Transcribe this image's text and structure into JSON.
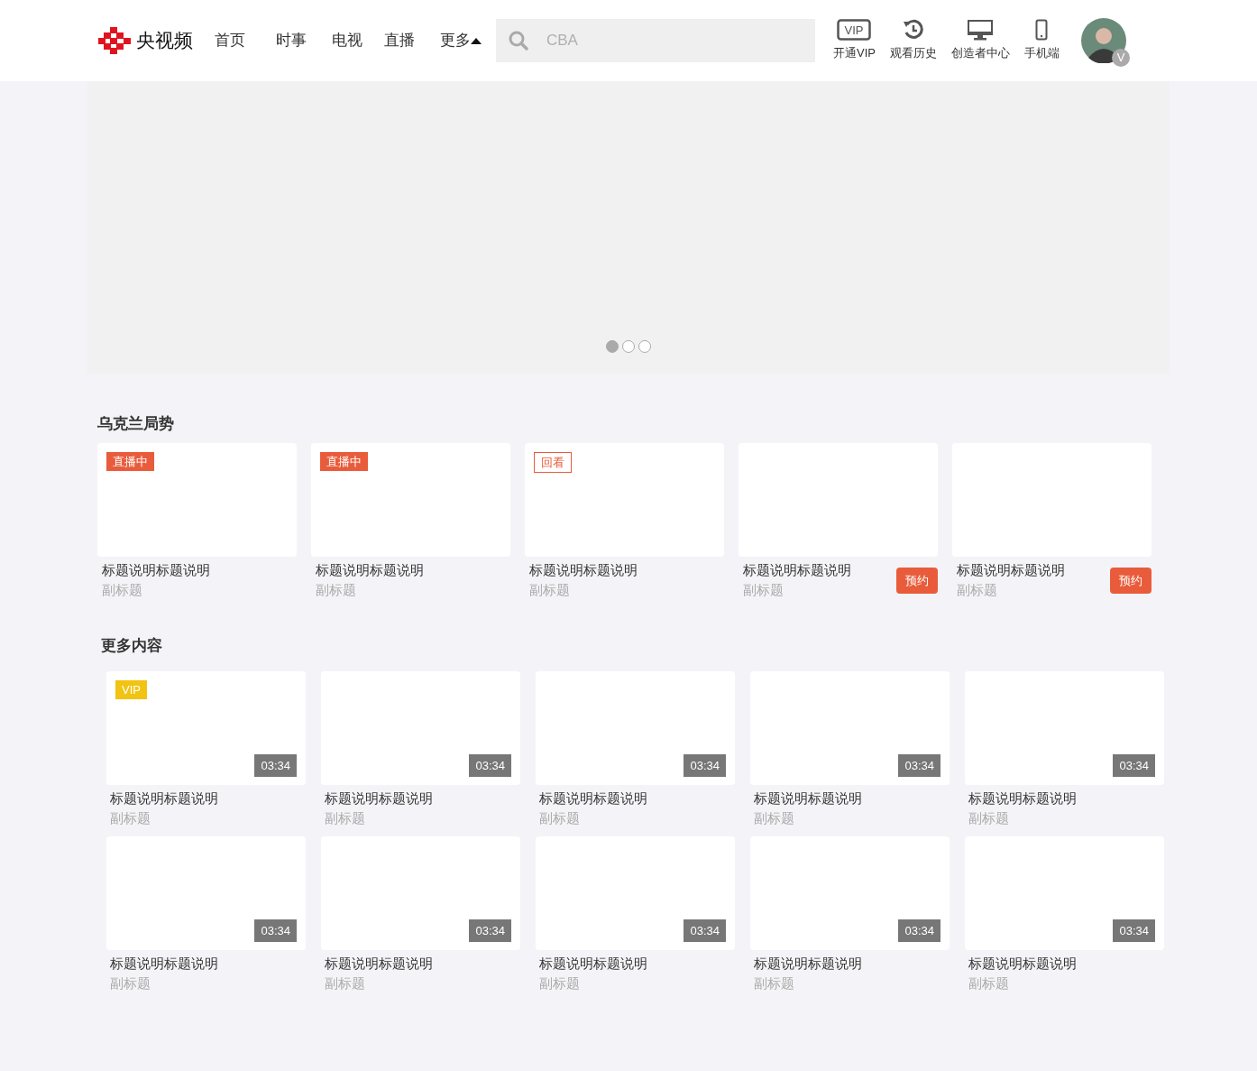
{
  "header": {
    "logo": "央视频",
    "nav": [
      "首页",
      "时事",
      "电视",
      "直播"
    ],
    "more": "更多",
    "search": {
      "placeholder": "CBA"
    },
    "actions": [
      {
        "kind": "vip",
        "label": "开通VIP",
        "icon_text": "VIP"
      },
      {
        "kind": "history",
        "label": "观看历史"
      },
      {
        "kind": "monitor",
        "label": "创造者中心"
      },
      {
        "kind": "phone",
        "label": "手机端"
      }
    ],
    "avatar_badge": "V"
  },
  "banner": {
    "dots": [
      {
        "selected": true
      },
      {
        "selected": false
      },
      {
        "selected": false
      }
    ]
  },
  "sections": [
    {
      "title": "乌克兰局势",
      "items": [
        {
          "tag": {
            "kind": "live",
            "text": "直播中"
          },
          "title": "标题说明标题说明",
          "subtitle": "副标题"
        },
        {
          "tag": {
            "kind": "live",
            "text": "直播中"
          },
          "title": "标题说明标题说明",
          "subtitle": "副标题"
        },
        {
          "tag": {
            "kind": "replay",
            "text": "回看"
          },
          "title": "标题说明标题说明",
          "subtitle": "副标题"
        },
        {
          "title": "标题说明标题说明",
          "subtitle": "副标题",
          "button": "预约"
        },
        {
          "title": "标题说明标题说明",
          "subtitle": "副标题",
          "button": "预约"
        }
      ]
    },
    {
      "title": "更多内容",
      "items": [
        {
          "tag": {
            "kind": "vip",
            "text": "VIP"
          },
          "duration": "03:34",
          "title": "标题说明标题说明",
          "subtitle": "副标题"
        },
        {
          "duration": "03:34",
          "title": "标题说明标题说明",
          "subtitle": "副标题"
        },
        {
          "duration": "03:34",
          "title": "标题说明标题说明",
          "subtitle": "副标题"
        },
        {
          "duration": "03:34",
          "title": "标题说明标题说明",
          "subtitle": "副标题"
        },
        {
          "duration": "03:34",
          "title": "标题说明标题说明",
          "subtitle": "副标题"
        },
        {
          "duration": "03:34",
          "title": "标题说明标题说明",
          "subtitle": "副标题"
        },
        {
          "duration": "03:34",
          "title": "标题说明标题说明",
          "subtitle": "副标题"
        },
        {
          "duration": "03:34",
          "title": "标题说明标题说明",
          "subtitle": "副标题"
        },
        {
          "duration": "03:34",
          "title": "标题说明标题说明",
          "subtitle": "副标题"
        },
        {
          "duration": "03:34",
          "title": "标题说明标题说明",
          "subtitle": "副标题"
        }
      ]
    }
  ]
}
